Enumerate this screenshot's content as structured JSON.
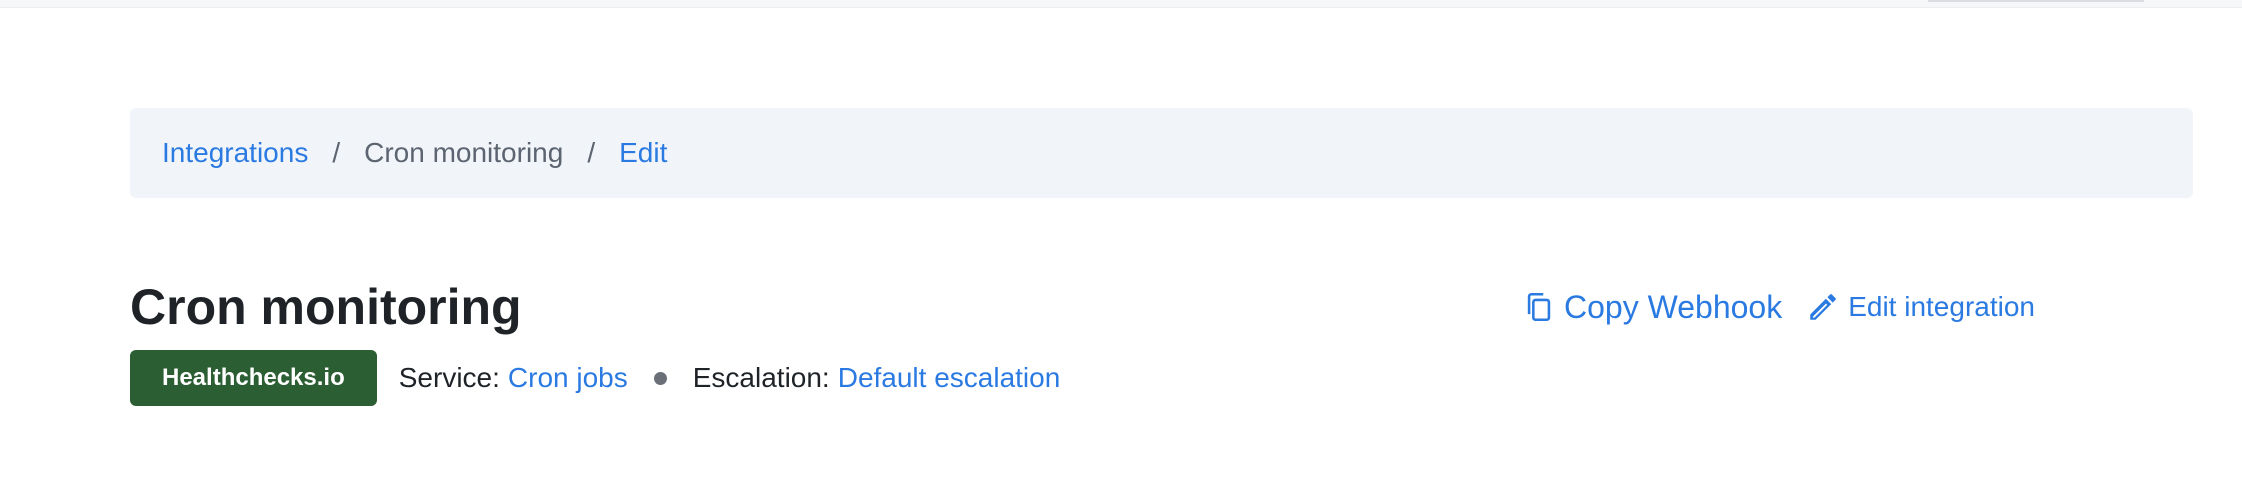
{
  "breadcrumb": {
    "integrations": "Integrations",
    "separator": "/",
    "current": "Cron monitoring",
    "edit": "Edit"
  },
  "header": {
    "title": "Cron monitoring",
    "badge": "Healthchecks.io",
    "service_label": "Service:",
    "service_value": "Cron jobs",
    "escalation_label": "Escalation:",
    "escalation_value": "Default escalation"
  },
  "actions": {
    "copy_webhook": {
      "label": "Copy Webhook",
      "icon": "copy-icon"
    },
    "edit_integration": {
      "label": "Edit integration",
      "icon": "pencil-icon"
    }
  },
  "colors": {
    "link": "#2a7ae2",
    "badge_bg": "#2b5e33",
    "breadcrumb_bg": "#f1f5f9"
  }
}
